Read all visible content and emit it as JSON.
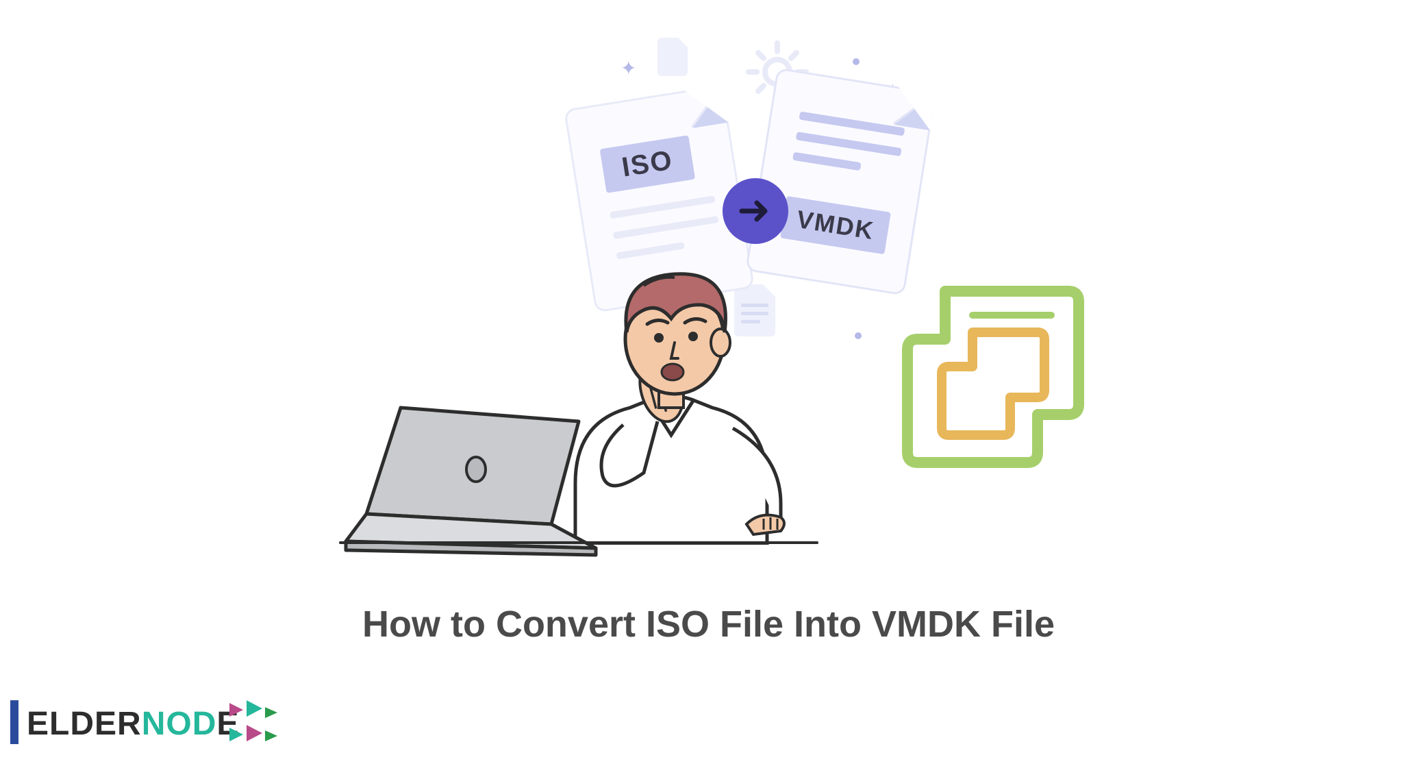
{
  "illustration": {
    "source_file_label": "ISO",
    "target_file_label": "VMDK",
    "arrow_direction": "right"
  },
  "title": "How to Convert ISO File Into VMDK File",
  "brand": {
    "name": "ELDERNODE",
    "accent_color_1": "#2a4b9b",
    "accent_color_2": "#25b79b"
  },
  "icons": {
    "gear": "gear-icon",
    "arrow": "arrow-right-icon",
    "vmware": "vmware-workstation-icon",
    "laptop": "laptop-icon",
    "person": "surprised-person-icon",
    "sparkle": "plus-sparkle-icon"
  },
  "colors": {
    "doc_border": "#e8eaf8",
    "label_bg": "#c5c9f0",
    "arrow_bg": "#5b52c9",
    "vm_green": "#a6cf6b",
    "vm_yellow": "#e8b75a",
    "title_color": "#4a4a4a"
  }
}
